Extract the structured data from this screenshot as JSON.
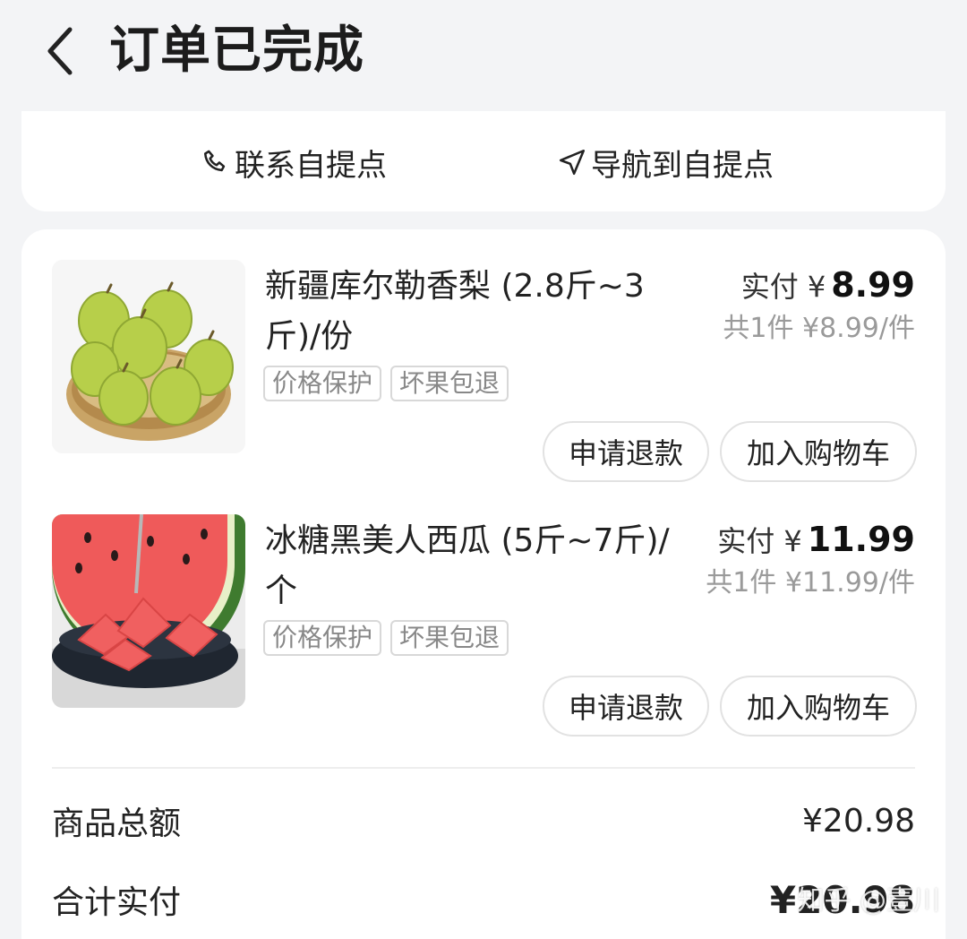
{
  "header": {
    "title": "订单已完成",
    "back_icon": "chevron-left-icon"
  },
  "pickup_actions": {
    "contact_label": "联系自提点",
    "navigate_label": "导航到自提点"
  },
  "items": [
    {
      "name": "新疆库尔勒香梨 (2.8斤~3斤)/份",
      "tags": [
        "价格保护",
        "坏果包退"
      ],
      "paid_label": "实付 ¥",
      "paid_amount": "8.99",
      "unit_summary": "共1件 ¥8.99/件",
      "refund_label": "申请退款",
      "cart_label": "加入购物车"
    },
    {
      "name": "冰糖黑美人西瓜 (5斤~7斤)/个",
      "tags": [
        "价格保护",
        "坏果包退"
      ],
      "paid_label": "实付 ¥",
      "paid_amount": "11.99",
      "unit_summary": "共1件 ¥11.99/件",
      "refund_label": "申请退款",
      "cart_label": "加入购物车"
    }
  ],
  "summary": {
    "goods_total_label": "商品总额",
    "goods_total_value": "¥20.98",
    "paid_total_label": "合计实付",
    "paid_total_value": "¥20.98"
  },
  "watermark": "知乎 @壹川",
  "colors": {
    "background": "#f3f4f6",
    "card": "#ffffff",
    "text": "#1c1c1c",
    "muted": "#9a9a9a"
  }
}
